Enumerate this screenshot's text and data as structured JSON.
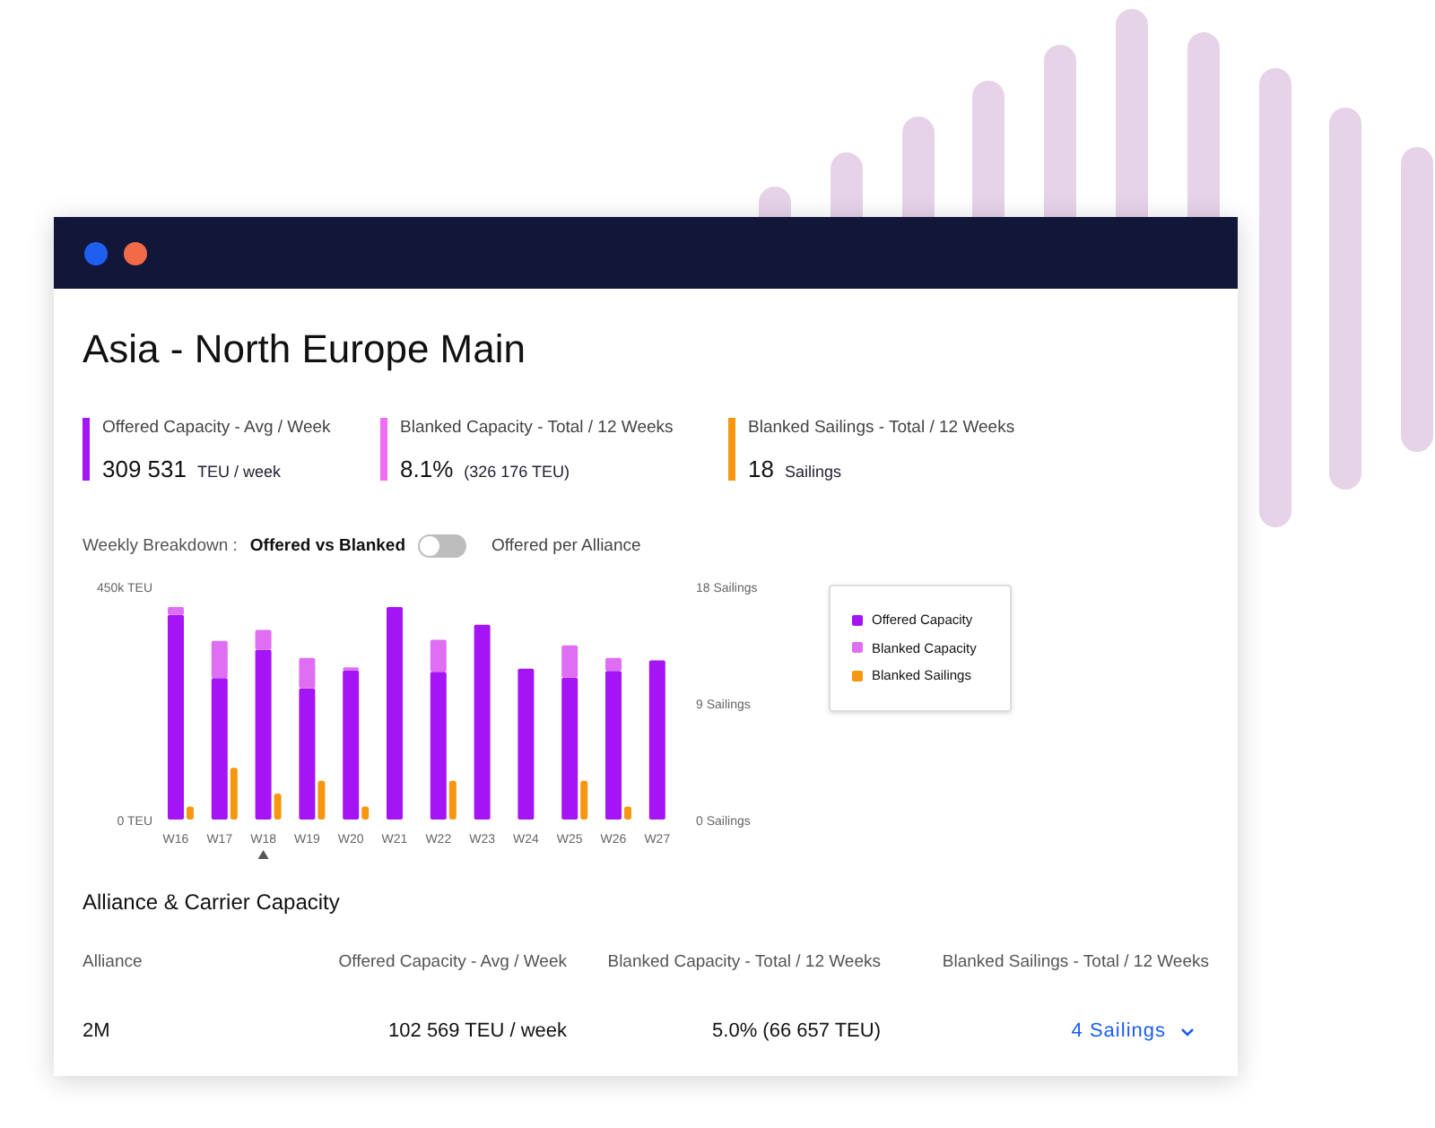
{
  "window": {
    "title": "Asia - North Europe Main"
  },
  "kpis": [
    {
      "label": "Offered Capacity - Avg / Week",
      "value": "309 531",
      "unit": "TEU / week",
      "color": "#a514f5"
    },
    {
      "label": "Blanked Capacity - Total / 12 Weeks",
      "value": "8.1%",
      "unit": "(326 176 TEU)",
      "color": "#f06cf5"
    },
    {
      "label": "Blanked Sailings - Total / 12 Weeks",
      "value": "18",
      "unit": "Sailings",
      "color": "#f7960f"
    }
  ],
  "breakdown": {
    "label": "Weekly Breakdown :",
    "option_left": "Offered vs Blanked",
    "option_right": "Offered per Alliance",
    "on": false
  },
  "chart": {
    "chart_data": {
      "type": "bar",
      "stacked": true,
      "categories": [
        "W16",
        "W17",
        "W18",
        "W19",
        "W20",
        "W21",
        "W22",
        "W23",
        "W24",
        "W25",
        "W26",
        "W27"
      ],
      "ylim": [
        0,
        450000
      ],
      "yticks": [
        {
          "value": 0,
          "label": "0 TEU"
        },
        {
          "value": 450000,
          "label": "450k TEU"
        }
      ],
      "y2lim": [
        0,
        18
      ],
      "y2ticks": [
        {
          "value": 0,
          "label": "0 Sailings"
        },
        {
          "value": 9,
          "label": "9 Sailings"
        },
        {
          "value": 18,
          "label": "18 Sailings"
        }
      ],
      "series": [
        {
          "name": "Offered Capacity",
          "color": "#a514f5",
          "values": [
            395000,
            273000,
            328000,
            253000,
            288000,
            410000,
            285000,
            376000,
            291000,
            274000,
            287000,
            307000
          ]
        },
        {
          "name": "Blanked Capacity",
          "color": "#df6ef2",
          "values": [
            15000,
            72000,
            38000,
            59000,
            6000,
            0,
            62000,
            0,
            0,
            62000,
            25000,
            0
          ]
        },
        {
          "name": "Blanked Sailings",
          "color": "#f7960f",
          "axis": "y2",
          "values": [
            1,
            4,
            2,
            3,
            1,
            0,
            3,
            0,
            0,
            3,
            1,
            0
          ]
        }
      ],
      "annotations": [
        {
          "x": "W18"
        }
      ]
    }
  },
  "alliance_section": {
    "title": "Alliance & Carrier Capacity",
    "columns": [
      "Alliance",
      "Offered Capacity - Avg / Week",
      "Blanked Capacity - Total / 12 Weeks",
      "Blanked Sailings - Total / 12 Weeks"
    ],
    "rows": [
      {
        "alliance": "2M",
        "offered": "102 569 TEU / week",
        "blanked": "5.0% (66 657 TEU)",
        "sailings": "4 Sailings",
        "expanded": false
      }
    ]
  }
}
